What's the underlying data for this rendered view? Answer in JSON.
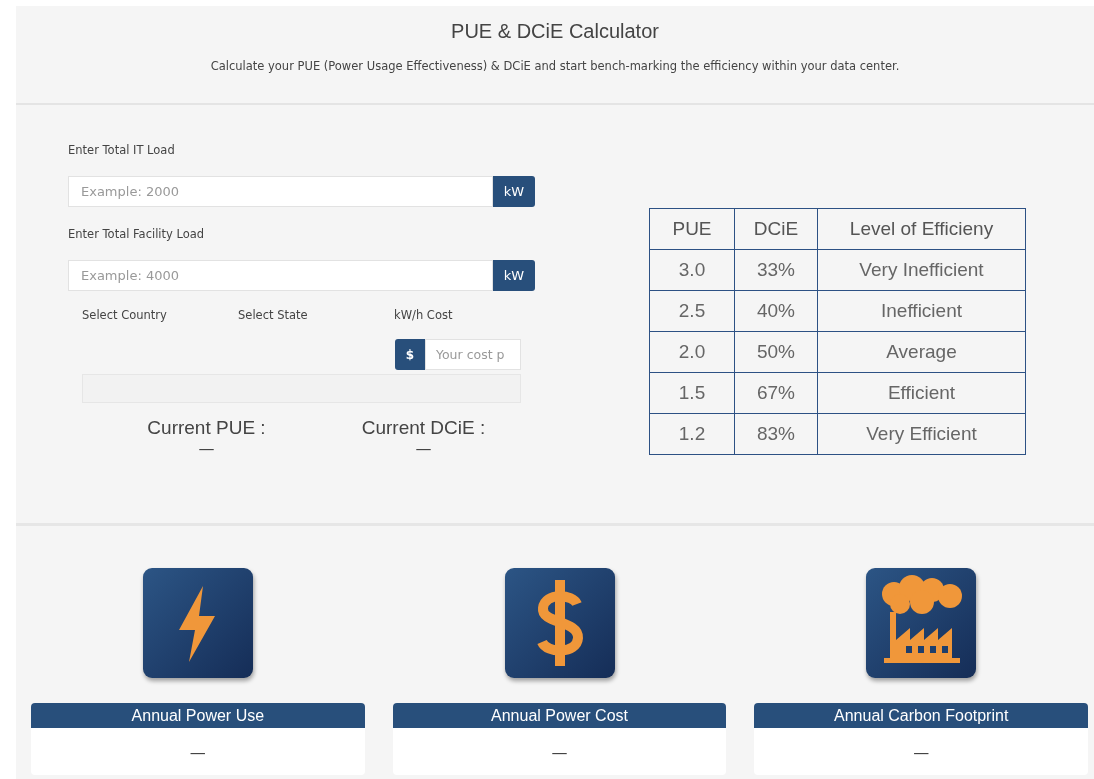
{
  "header": {
    "title": "PUE & DCiE Calculator",
    "subtitle": "Calculate your PUE (Power Usage Effectiveness) & DCiE and start bench-marking the efficiency within your data center."
  },
  "inputs": [
    {
      "label": "Enter Total IT Load",
      "placeholder": "Example: 2000",
      "unit": "kW"
    },
    {
      "label": "Enter Total Facility Load",
      "placeholder": "Example: 4000",
      "unit": "kW"
    }
  ],
  "selectors": [
    "Select Country",
    "Select State"
  ],
  "cost": {
    "label": "kW/h Cost",
    "prefix": "$",
    "placeholder": "Your cost p"
  },
  "results": [
    {
      "label": "Current PUE :",
      "value": "—"
    },
    {
      "label": "Current DCiE :",
      "value": "—"
    }
  ],
  "table": {
    "columns": [
      "PUE",
      "DCiE",
      "Level of Efficieny"
    ],
    "rows": [
      [
        "3.0",
        "33%",
        "Very Inefficient"
      ],
      [
        "2.5",
        "40%",
        "Inefficient"
      ],
      [
        "2.0",
        "50%",
        "Average"
      ],
      [
        "1.5",
        "67%",
        "Efficient"
      ],
      [
        "1.2",
        "83%",
        "Very Efficient"
      ]
    ]
  },
  "metrics": [
    {
      "kind": "bolt",
      "label": "Annual Power Use",
      "value": "—"
    },
    {
      "kind": "dollar",
      "label": "Annual Power Cost",
      "value": "—"
    },
    {
      "kind": "factory",
      "label": "Annual Carbon Footprint",
      "value": "—"
    }
  ]
}
